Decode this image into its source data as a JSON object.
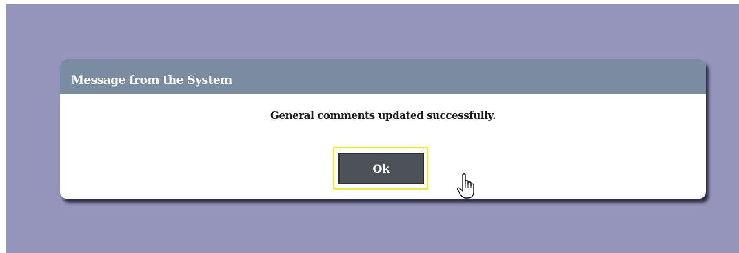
{
  "page": {
    "background_color": "#9594ba"
  },
  "dialog": {
    "title": "Message from the System",
    "message": "General comments updated successfully.",
    "ok_label": "Ok",
    "titlebar_color": "#7a8ca2",
    "focus_ring_color": "#f3ee1a",
    "button_color": "#4d5158"
  },
  "cursor": {
    "icon": "hand-pointer-icon"
  }
}
